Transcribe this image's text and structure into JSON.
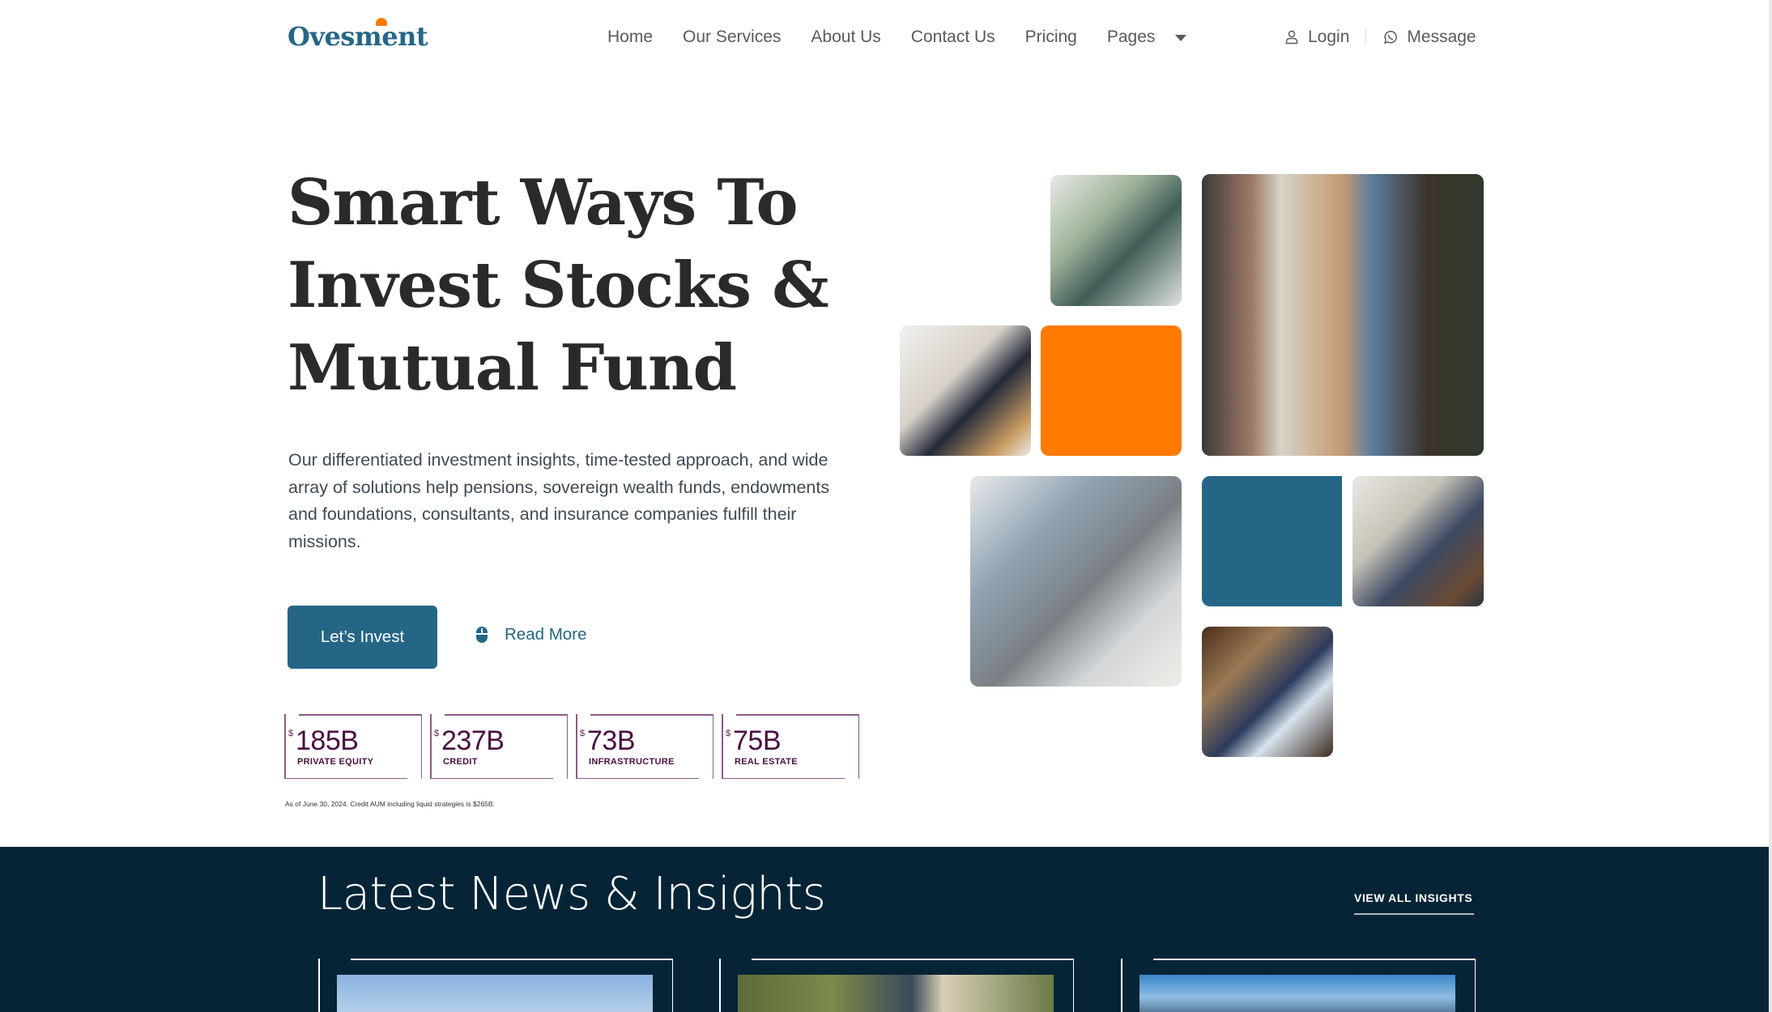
{
  "header": {
    "logo": "Ovesment",
    "nav": [
      {
        "label": "Home"
      },
      {
        "label": "Our Services"
      },
      {
        "label": "About Us"
      },
      {
        "label": "Contact Us"
      },
      {
        "label": "Pricing"
      },
      {
        "label": "Pages",
        "has_dropdown": true
      }
    ],
    "login_label": "Login",
    "message_label": "Message"
  },
  "hero": {
    "title_lines": [
      "Smart Ways To",
      "Invest Stocks &",
      "Mutual Fund"
    ],
    "description": "Our differentiated investment insights, time-tested approach, and wide array of solutions help pensions, sovereign wealth funds, endowments and foundations, consultants, and insurance companies fulfill their missions.",
    "primary_button": "Let’s Invest",
    "secondary_button": "Read More",
    "secondary_icon": "mouse-icon"
  },
  "stats": {
    "items": [
      {
        "currency": "$",
        "value": "185B",
        "label": "PRIVATE EQUITY"
      },
      {
        "currency": "$",
        "value": "237B",
        "label": "CREDIT"
      },
      {
        "currency": "$",
        "value": "73B",
        "label": "INFRASTRUCTURE"
      },
      {
        "currency": "$",
        "value": "75B",
        "label": "REAL ESTATE"
      }
    ],
    "footnote": "As of June 30, 2024. Credit AUM including liquid strategies is $265B."
  },
  "collage": {
    "accent_colors": {
      "orange": "#ff7a00",
      "blue": "#256687"
    },
    "photos": [
      "man-with-glasses-at-desk",
      "man-in-tan-blazer-with-phone",
      "man-on-staircase",
      "man-in-grey-suit-at-office",
      "man-gesturing-in-meeting",
      "man-in-navy-suit-with-phone"
    ]
  },
  "insights": {
    "title": "Latest News & Insights",
    "view_all": "VIEW ALL INSIGHTS",
    "cards": [
      {
        "image": "sky-landscape"
      },
      {
        "image": "blurred-street"
      },
      {
        "image": "city-skyline"
      }
    ]
  },
  "theme": {
    "brand": "#256687",
    "accent": "#ff7a00",
    "dark_bg": "#072436",
    "stat_color": "#4a0f42"
  }
}
